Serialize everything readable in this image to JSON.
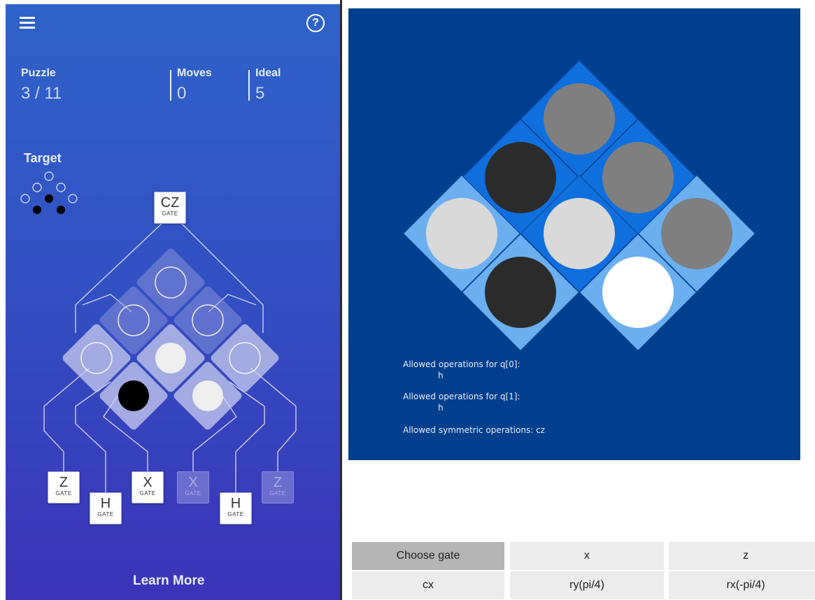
{
  "app": {
    "help_glyph": "?",
    "puzzle": {
      "label": "Puzzle",
      "value": "3 / 11"
    },
    "moves": {
      "label": "Moves",
      "value": "0"
    },
    "ideal": {
      "label": "Ideal",
      "value": "5"
    },
    "target_label": "Target",
    "learn_more": "Learn More",
    "gate_subtitle": "GATE",
    "top_gate": {
      "name": "CZ",
      "enabled": true
    },
    "gates": [
      {
        "name": "Z",
        "enabled": true
      },
      {
        "name": "H",
        "enabled": true
      },
      {
        "name": "X",
        "enabled": true
      },
      {
        "name": "X",
        "enabled": false
      },
      {
        "name": "H",
        "enabled": true
      },
      {
        "name": "Z",
        "enabled": false
      }
    ],
    "board_cells": [
      "empty",
      "empty",
      "empty",
      "empty",
      "half",
      "empty",
      "black",
      "half"
    ],
    "target_cells": [
      "empty",
      "empty",
      "empty",
      "empty",
      "black",
      "empty",
      "black",
      "black"
    ]
  },
  "viz": {
    "cells": [
      {
        "fill": "#7f7f7f"
      },
      {
        "fill": "#2b2b2b"
      },
      {
        "fill": "#7f7f7f"
      },
      {
        "fill": "#d9d9d9"
      },
      {
        "fill": "#d9d9d9"
      },
      {
        "fill": "#7f7f7f"
      },
      {
        "fill": "#2b2b2b"
      },
      {
        "fill": "#ffffff"
      }
    ],
    "ops": [
      {
        "text": "Allowed operations for q[0]:"
      },
      {
        "text": "h"
      },
      {
        "text": "Allowed operations for q[1]:"
      },
      {
        "text": "h"
      },
      {
        "text": "Allowed symmetric operations:  cz"
      }
    ]
  },
  "buttons": [
    {
      "label": "Choose gate",
      "selected": true
    },
    {
      "label": "x",
      "selected": false
    },
    {
      "label": "z",
      "selected": false
    },
    {
      "label": "cx",
      "selected": false
    },
    {
      "label": "ry(pi/4)",
      "selected": false
    },
    {
      "label": "rx(-pi/4)",
      "selected": false
    }
  ],
  "colors": {
    "viz_bg": "#003f8d",
    "tile_mid": "#0f6fde",
    "tile_light": "#6aaff0"
  }
}
